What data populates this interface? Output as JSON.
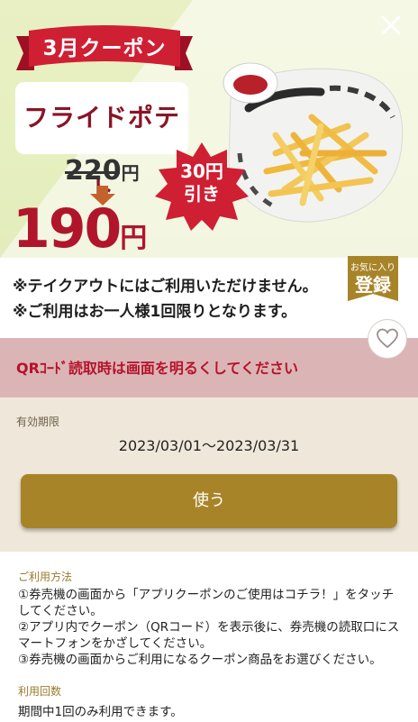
{
  "coupon": {
    "ribbon": "3月クーポン",
    "product_name": "フライドポテト",
    "old_price": "220",
    "new_price": "190",
    "yen": "円",
    "discount_line1": "30円",
    "discount_line2": "引き"
  },
  "notes": {
    "line1": "※テイクアウトにはご利用いただけません。",
    "line2": "※ご利用はお一人様1回限りとなります。"
  },
  "favorite": {
    "small": "お気に入り",
    "big": "登録"
  },
  "qr_notice": "QRｺｰﾄﾞ読取時は画面を明るくしてください",
  "validity": {
    "label": "有効期限",
    "value": "2023/03/01〜2023/03/31"
  },
  "use_button": "使う",
  "usage": {
    "label": "ご利用方法",
    "steps": [
      "①券売機の画面から「アプリクーポンのご使用はコチラ！」をタッチしてください。",
      "②アプリ内でクーポン（QRコード）を表示後に、券売機の読取口にスマートフォンをかざしてください。",
      "③券売機の画面からご利用になるクーポン商品をお選びください。"
    ]
  },
  "count": {
    "label": "利用回数",
    "value": "期間中1回のみ利用できます。"
  },
  "colors": {
    "accent": "#a88428",
    "brand_red": "#b0152b",
    "qr_band": "#dbb5b5",
    "validity_bg": "#efe8da"
  },
  "icons": {
    "close": "close-icon",
    "heart": "heart-icon",
    "arrow": "arrow-down-icon"
  }
}
